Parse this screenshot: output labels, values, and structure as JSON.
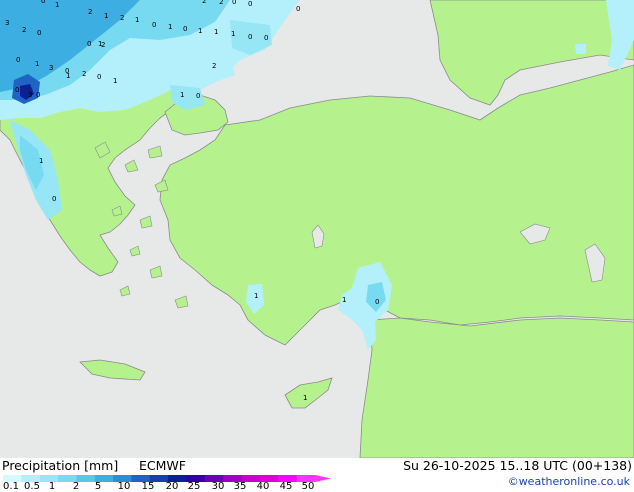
{
  "map": {
    "label_values": [
      "3",
      "1",
      "2",
      "1",
      "2",
      "1",
      "0",
      "1",
      "0",
      "1",
      "1",
      "1",
      "0",
      "0",
      "0",
      "0",
      "2",
      "2",
      "2",
      "0",
      "0",
      "2",
      "0",
      "0",
      "0",
      "1",
      "3",
      "0",
      "2",
      "0",
      "1",
      "3",
      "0",
      "2",
      "1",
      "0",
      "1",
      "0",
      "1",
      "1",
      "0",
      "1",
      "0",
      "1",
      "1"
    ],
    "colors": {
      "sea": "#e7e8e8",
      "land": "#b5f28e",
      "coast": "#8a8a8a"
    }
  },
  "legend": {
    "title": "Precipitation [mm]",
    "model": "ECMWF",
    "scale_colors": [
      "#d6fbff",
      "#b4f0fb",
      "#96e6f5",
      "#78daf0",
      "#57c8ea",
      "#3caee2",
      "#2a8fd6",
      "#1f63c4",
      "#1540ae",
      "#0a2094",
      "#3300a6",
      "#6b00b5",
      "#9f00c4",
      "#c800cc",
      "#e000d6",
      "#ff00ff",
      "#ff33ff"
    ],
    "ticks": [
      "0.1",
      "0.5",
      "1",
      "2",
      "5",
      "10",
      "15",
      "20",
      "25",
      "30",
      "35",
      "40",
      "45",
      "50"
    ]
  },
  "valid_time": "Su 26-10-2025 15..18 UTC (00+138)",
  "credit": "©weatheronline.co.uk"
}
